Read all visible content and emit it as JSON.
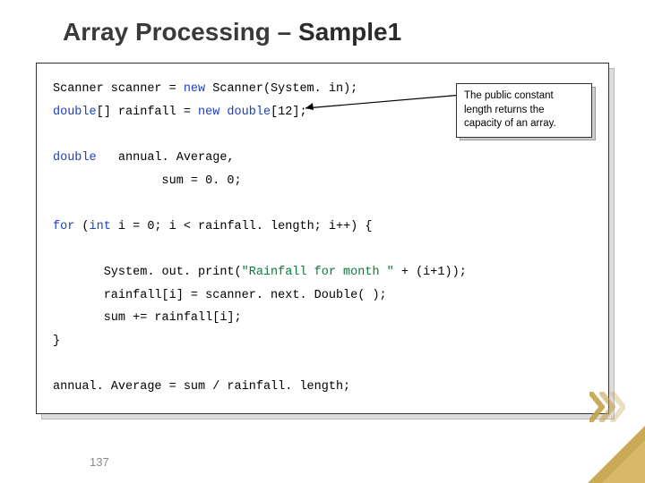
{
  "title_prefix": "Array Processing – ",
  "title_emph": "Sample1",
  "code": {
    "l1a": "Scanner scanner = ",
    "l1b": "new",
    "l1c": " Scanner(System. in);",
    "l2a": "double",
    "l2b": "[] rainfall = ",
    "l2c": "new double",
    "l2d": "[12];",
    "l3a": "double",
    "l3b": "   annual. Average,",
    "l4": "               sum = 0. 0;",
    "l5a": "for",
    "l5b": " (",
    "l5c": "int",
    "l5d": " i = 0; i < rainfall. length; i++) {",
    "l6a": "       System. out. print(",
    "l6b": "\"Rainfall for month \"",
    "l6c": " + (i+1));",
    "l7": "       rainfall[i] = scanner. next. Double( );",
    "l8": "       sum += rainfall[i];",
    "l9": "}",
    "l10": "annual. Average = sum / rainfall. length;"
  },
  "callout": {
    "t1": "The public constant ",
    "kw": "length",
    "t2": " returns the capacity of an array."
  },
  "pagenum": "137"
}
